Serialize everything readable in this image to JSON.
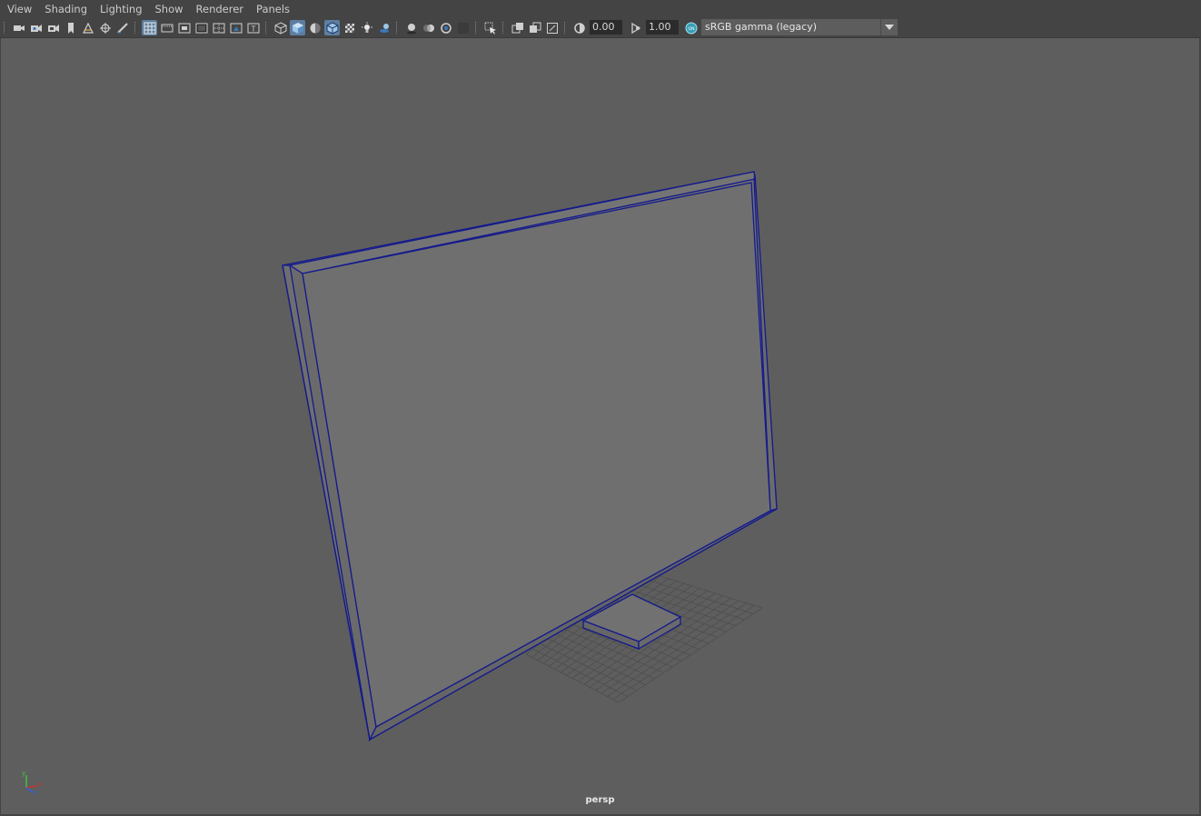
{
  "menu": {
    "items": [
      "View",
      "Shading",
      "Lighting",
      "Show",
      "Renderer",
      "Panels"
    ]
  },
  "toolbar": {
    "exposure_value": "0.00",
    "gamma_value": "1.00",
    "color_space": "sRGB gamma (legacy)",
    "icons": [
      "select-camera-icon",
      "camera-attributes-icon",
      "bookmarks-icon",
      "image-plane-icon",
      "grid-icon",
      "film-gate-icon",
      "resolution-gate-icon",
      "gate-mask-icon",
      "field-chart-icon",
      "safe-action-icon",
      "safe-title-icon",
      "wireframe-icon",
      "smooth-shade-icon",
      "default-material-icon",
      "wireframe-on-shaded-icon",
      "textured-icon",
      "use-all-lights-icon",
      "shadows-icon",
      "screen-space-ao-icon",
      "motion-blur-icon",
      "multisample-aa-icon",
      "depth-of-field-icon",
      "isolate-select-icon",
      "xray-icon",
      "xray-joints-icon",
      "xray-components-icon",
      "exposure-icon",
      "gamma-icon",
      "color-management-icon"
    ]
  },
  "viewport": {
    "camera_name": "persp",
    "background_color": "#5e5e5e",
    "wire_color": "#141a8c",
    "axis": {
      "y_label": "y",
      "x_label": "x",
      "z_label": "z"
    }
  },
  "colors": {
    "ui_bg": "#444444",
    "active_button": "#5d7ea0",
    "field_bg": "#2b2b2b"
  }
}
